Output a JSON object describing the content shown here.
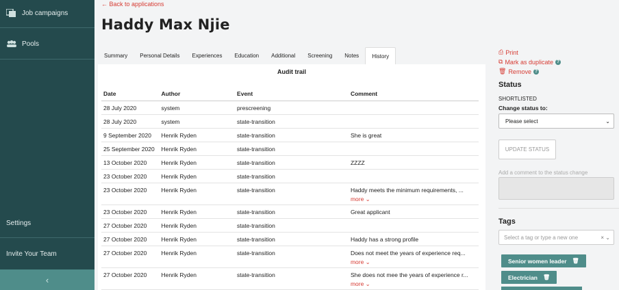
{
  "sidebar": {
    "items": [
      {
        "label": "Job campaigns",
        "icon": "layers-icon"
      },
      {
        "label": "Pools",
        "icon": "people-icon"
      }
    ],
    "bottom_items": [
      {
        "label": "Settings"
      },
      {
        "label": "Invite Your Team"
      }
    ],
    "collapse_icon": "chevron-left-icon"
  },
  "header": {
    "back_label": "← Back to applications",
    "title": "Haddy Max Njie"
  },
  "tabs": [
    {
      "label": "Summary"
    },
    {
      "label": "Personal Details"
    },
    {
      "label": "Experiences"
    },
    {
      "label": "Education"
    },
    {
      "label": "Additional"
    },
    {
      "label": "Screening"
    },
    {
      "label": "Notes"
    },
    {
      "label": "History",
      "active": true
    }
  ],
  "audit": {
    "title": "Audit trail",
    "columns": [
      "Date",
      "Author",
      "Event",
      "Comment"
    ],
    "more_label": "more",
    "rows": [
      {
        "date": "28 July 2020",
        "author": "system",
        "event": "prescreening",
        "comment": "",
        "more": false
      },
      {
        "date": "28 July 2020",
        "author": "system",
        "event": "state-transition",
        "comment": "",
        "more": false
      },
      {
        "date": "9 September 2020",
        "author": "Henrik Ryden",
        "event": "state-transition",
        "comment": "She is great",
        "more": false
      },
      {
        "date": "25 September 2020",
        "author": "Henrik Ryden",
        "event": "state-transition",
        "comment": "",
        "more": false
      },
      {
        "date": "13 October 2020",
        "author": "Henrik Ryden",
        "event": "state-transition",
        "comment": "ZZZZ",
        "more": false
      },
      {
        "date": "23 October 2020",
        "author": "Henrik Ryden",
        "event": "state-transition",
        "comment": "",
        "more": false
      },
      {
        "date": "23 October 2020",
        "author": "Henrik Ryden",
        "event": "state-transition",
        "comment": "Haddy meets the minimum requirements, ...",
        "more": true
      },
      {
        "date": "23 October 2020",
        "author": "Henrik Ryden",
        "event": "state-transition",
        "comment": "Great applicant",
        "more": false
      },
      {
        "date": "27 October 2020",
        "author": "Henrik Ryden",
        "event": "state-transition",
        "comment": "",
        "more": false
      },
      {
        "date": "27 October 2020",
        "author": "Henrik Ryden",
        "event": "state-transition",
        "comment": "Haddy has a strong profile",
        "more": false
      },
      {
        "date": "27 October 2020",
        "author": "Henrik Ryden",
        "event": "state-transition",
        "comment": "Does not meet the years of experience req...",
        "more": true
      },
      {
        "date": "27 October 2020",
        "author": "Henrik Ryden",
        "event": "state-transition",
        "comment": "She does not mee the years of experience r...",
        "more": true
      }
    ]
  },
  "actions": {
    "print_label": "Print",
    "duplicate_label": "Mark as duplicate",
    "remove_label": "Remove"
  },
  "status": {
    "title": "Status",
    "value": "SHORTLISTED",
    "change_label": "Change status to:",
    "select_value": "Please select",
    "update_label": "UPDATE STATUS",
    "comment_placeholder": "Add a comment to the status change"
  },
  "tags": {
    "title": "Tags",
    "placeholder": "Select a tag or type a new one",
    "items": [
      "Senior women leader",
      "Electrician"
    ]
  },
  "colors": {
    "sidebar": "#244a4d",
    "accent": "#4f8d8a",
    "link": "#d63b33"
  }
}
